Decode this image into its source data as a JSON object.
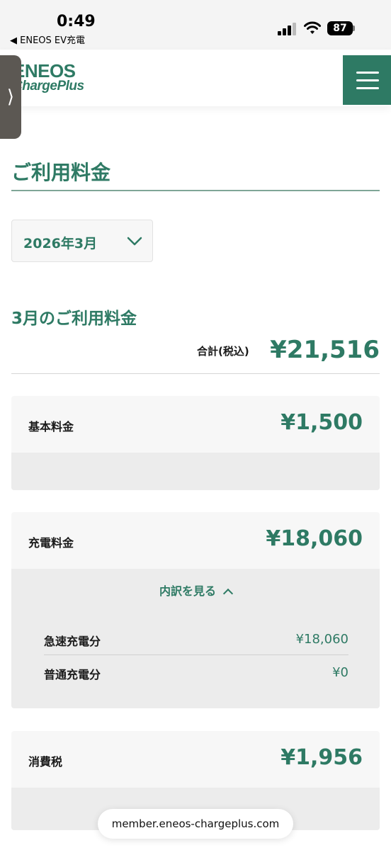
{
  "status": {
    "time": "0:49",
    "back_app": "◀ ENEOS EV充電",
    "battery": "87"
  },
  "header": {
    "logo_top": "ENEOS",
    "logo_bottom": "ChargePlus",
    "side_tab_glyph": "⟩"
  },
  "page": {
    "title": "ご利用料金",
    "month_selected": "2026年3月",
    "section_title": "3月のご利用料金",
    "total_label": "合計(税込)",
    "total_value": "¥21,516"
  },
  "cards": {
    "basic": {
      "label": "基本料金",
      "amount": "¥1,500"
    },
    "charging": {
      "label": "充電料金",
      "amount": "¥18,060",
      "toggle_label": "内訳を見る",
      "items": [
        {
          "label": "急速充電分",
          "value": "¥18,060"
        },
        {
          "label": "普通充電分",
          "value": "¥0"
        }
      ]
    },
    "tax": {
      "label": "消費税",
      "amount": "¥1,956"
    }
  },
  "browser": {
    "url": "member.eneos-chargeplus.com"
  },
  "colors": {
    "accent": "#2e7a64",
    "card_bg": "#f7f7f7",
    "card_sub_bg": "#ececec"
  }
}
